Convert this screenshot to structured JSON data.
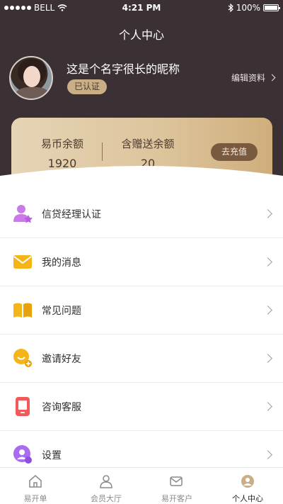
{
  "status": {
    "carrier": "BELL",
    "time": "4:21 PM",
    "battery": "100%"
  },
  "page": {
    "title": "个人中心"
  },
  "profile": {
    "nickname": "这是个名字很长的昵称",
    "verified": "已认证",
    "edit": "编辑资料"
  },
  "wallet": {
    "coin_label": "易币余额",
    "coin_value": "1920",
    "gift_label": "含赠送余额",
    "gift_value": "20",
    "recharge": "去充值"
  },
  "menu": [
    {
      "label": "信贷经理认证",
      "icon": "badge-star-icon",
      "color": "#c97be8"
    },
    {
      "label": "我的消息",
      "icon": "envelope-icon",
      "color": "#f5b518"
    },
    {
      "label": "常见问题",
      "icon": "book-icon",
      "color": "#f5b518"
    },
    {
      "label": "邀请好友",
      "icon": "invite-icon",
      "color": "#f5b518"
    },
    {
      "label": "咨询客服",
      "icon": "phone-icon",
      "color": "#f05a5a"
    },
    {
      "label": "设置",
      "icon": "gear-user-icon",
      "color": "#a96cf0"
    }
  ],
  "tabs": [
    {
      "label": "易开单",
      "icon": "home-icon",
      "active": false
    },
    {
      "label": "会员大厅",
      "icon": "member-icon",
      "active": false
    },
    {
      "label": "易开客户",
      "icon": "mail-user-icon",
      "active": false
    },
    {
      "label": "个人中心",
      "icon": "profile-icon",
      "active": true
    }
  ],
  "colors": {
    "header": "#3b3034",
    "gold": "#dcc39a",
    "accent_brown": "#7a5a3e"
  }
}
